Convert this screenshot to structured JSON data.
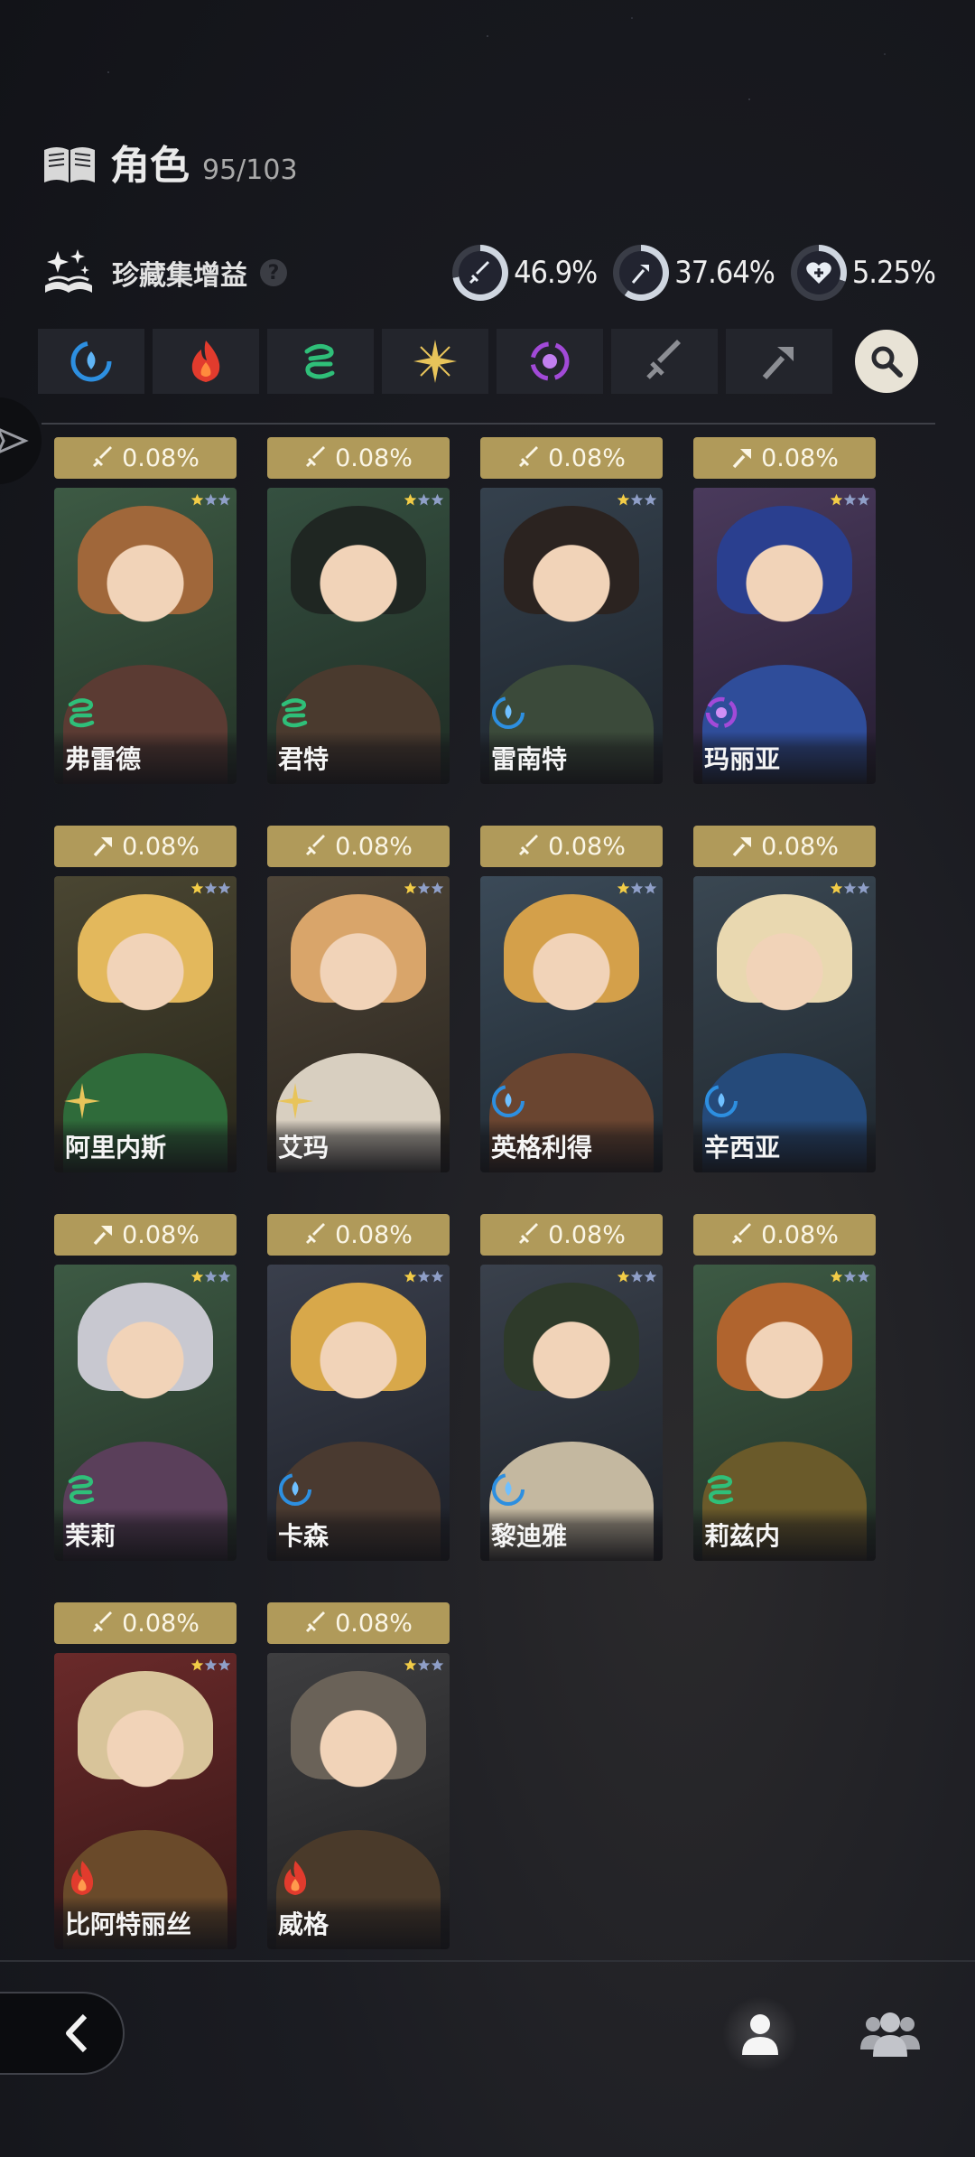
{
  "header": {
    "title": "角色",
    "count": "95/103",
    "book_icon": "book-icon"
  },
  "bonus": {
    "label": "珍藏集增益",
    "help_icon": "?",
    "stats": [
      {
        "icon": "sword-icon",
        "value": "46.9%"
      },
      {
        "icon": "staff-icon",
        "value": "37.64%"
      },
      {
        "icon": "heart-plus-icon",
        "value": "5.25%"
      }
    ]
  },
  "filters": [
    {
      "icon": "water-element-icon",
      "color": "#2d8fe0"
    },
    {
      "icon": "fire-element-icon",
      "color": "#e23b2d"
    },
    {
      "icon": "wind-element-icon",
      "color": "#2fbf79"
    },
    {
      "icon": "light-element-icon",
      "color": "#e8c45a"
    },
    {
      "icon": "dark-element-icon",
      "color": "#a24ad8"
    },
    {
      "icon": "sword-filter-icon",
      "color": "#8c8e94"
    },
    {
      "icon": "staff-filter-icon",
      "color": "#8c8e94"
    }
  ],
  "characters": [
    {
      "name": "弗雷德",
      "bonus": "0.08%",
      "type": "sword",
      "element": "wind",
      "stars": 1
    },
    {
      "name": "君特",
      "bonus": "0.08%",
      "type": "sword",
      "element": "wind",
      "stars": 1
    },
    {
      "name": "雷南特",
      "bonus": "0.08%",
      "type": "sword",
      "element": "water",
      "stars": 1
    },
    {
      "name": "玛丽亚",
      "bonus": "0.08%",
      "type": "staff",
      "element": "dark",
      "stars": 1
    },
    {
      "name": "阿里内斯",
      "bonus": "0.08%",
      "type": "staff",
      "element": "light",
      "stars": 1
    },
    {
      "name": "艾玛",
      "bonus": "0.08%",
      "type": "sword",
      "element": "light",
      "stars": 1
    },
    {
      "name": "英格利得",
      "bonus": "0.08%",
      "type": "sword",
      "element": "water",
      "stars": 1
    },
    {
      "name": "辛西亚",
      "bonus": "0.08%",
      "type": "staff",
      "element": "water",
      "stars": 1
    },
    {
      "name": "茉莉",
      "bonus": "0.08%",
      "type": "staff",
      "element": "wind",
      "stars": 1
    },
    {
      "name": "卡森",
      "bonus": "0.08%",
      "type": "sword",
      "element": "water",
      "stars": 1
    },
    {
      "name": "黎迪雅",
      "bonus": "0.08%",
      "type": "sword",
      "element": "water",
      "stars": 1
    },
    {
      "name": "莉兹内",
      "bonus": "0.08%",
      "type": "sword",
      "element": "wind",
      "stars": 1
    },
    {
      "name": "比阿特丽丝",
      "bonus": "0.08%",
      "type": "sword",
      "element": "fire",
      "stars": 1
    },
    {
      "name": "威格",
      "bonus": "0.08%",
      "type": "sword",
      "element": "fire",
      "stars": 1
    }
  ],
  "element_colors": {
    "water": "#2d8fe0",
    "fire": "#e23b2d",
    "wind": "#2fbf79",
    "light": "#e8c45a",
    "dark": "#a24ad8"
  },
  "nav": {
    "back_icon": "back-arrow-icon",
    "single_icon": "person-icon",
    "group_icon": "group-icon"
  }
}
